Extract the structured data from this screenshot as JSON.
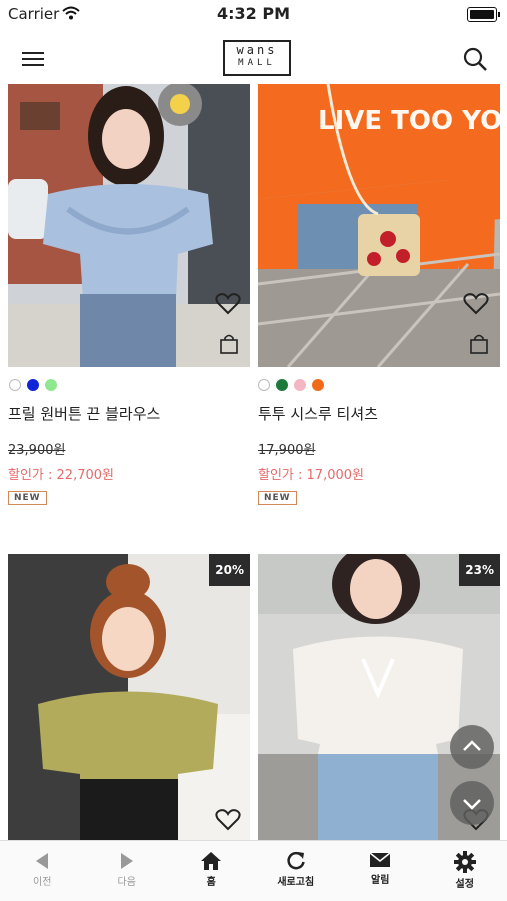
{
  "status_bar": {
    "carrier": "Carrier",
    "time": "4:32 PM"
  },
  "header": {
    "logo_top": "wans",
    "logo_bottom": "MALL"
  },
  "products": [
    {
      "name": "프릴 원버튼 끈 블라우스",
      "original_price": "23,900원",
      "sale_label": "할인가 : 22,700원",
      "badge": "NEW",
      "colors": [
        "#ffffff",
        "#1024d8",
        "#8fe88f"
      ]
    },
    {
      "name": "투투 시스루 티셔츠",
      "original_price": "17,900원",
      "sale_label": "할인가 : 17,000원",
      "badge": "NEW",
      "colors": [
        "#ffffff",
        "#1d7a3a",
        "#f4b6c2",
        "#f06a1a"
      ]
    },
    {
      "discount": "20%"
    },
    {
      "discount": "23%"
    }
  ],
  "bottom_nav": [
    {
      "icon": "back-arrow-icon",
      "label": "이전"
    },
    {
      "icon": "forward-arrow-icon",
      "label": "다음"
    },
    {
      "icon": "home-icon",
      "label": "홈"
    },
    {
      "icon": "refresh-icon",
      "label": "새로고침"
    },
    {
      "icon": "mail-icon",
      "label": "알림"
    },
    {
      "icon": "gear-icon",
      "label": "설정"
    }
  ],
  "fab": [
    {
      "icon": "chevron-up-icon"
    },
    {
      "icon": "chevron-down-icon"
    }
  ]
}
